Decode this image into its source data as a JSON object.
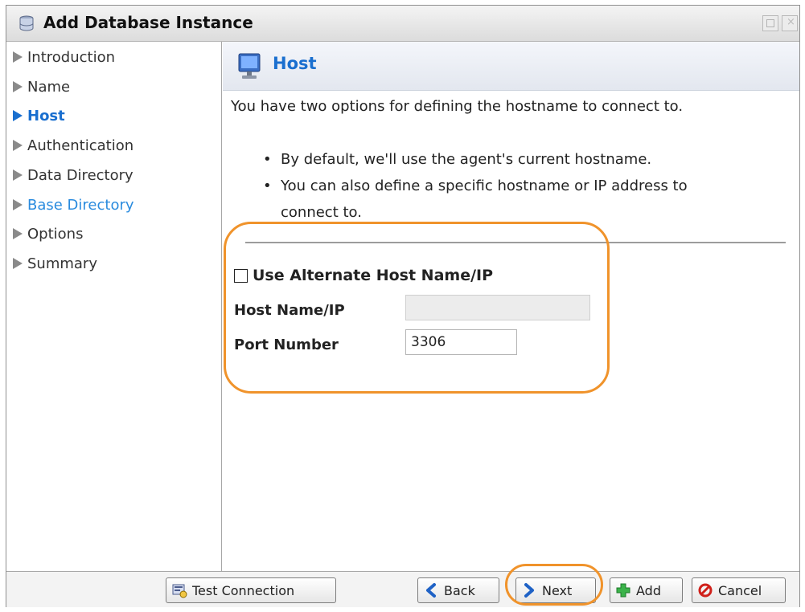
{
  "window": {
    "title": "Add Database Instance"
  },
  "sidebar": {
    "items": [
      {
        "label": "Introduction",
        "state": "normal"
      },
      {
        "label": "Name",
        "state": "normal"
      },
      {
        "label": "Host",
        "state": "active"
      },
      {
        "label": "Authentication",
        "state": "normal"
      },
      {
        "label": "Data Directory",
        "state": "normal"
      },
      {
        "label": "Base Directory",
        "state": "link"
      },
      {
        "label": "Options",
        "state": "normal"
      },
      {
        "label": "Summary",
        "state": "normal"
      }
    ]
  },
  "panel": {
    "title": "Host",
    "description": "You have two options for defining the hostname to connect to.",
    "bullets": [
      "By default, we'll use the agent's current hostname.",
      "You can also define a specific hostname or IP address to",
      "connect to."
    ]
  },
  "form": {
    "alt_host_checkbox_label": "Use Alternate Host Name/IP",
    "alt_host_checked": false,
    "host_label": "Host Name/IP",
    "host_value": "",
    "port_label": "Port Number",
    "port_value": "3306"
  },
  "footer": {
    "test_connection": "Test Connection",
    "back": "Back",
    "next": "Next",
    "add": "Add",
    "cancel": "Cancel"
  },
  "colors": {
    "accent": "#1a6fcf",
    "highlight": "#f0932b"
  },
  "icons": [
    "database-icon",
    "monitor-icon",
    "test-connection-icon",
    "back-arrow-icon",
    "next-arrow-icon",
    "add-plus-icon",
    "cancel-icon"
  ]
}
